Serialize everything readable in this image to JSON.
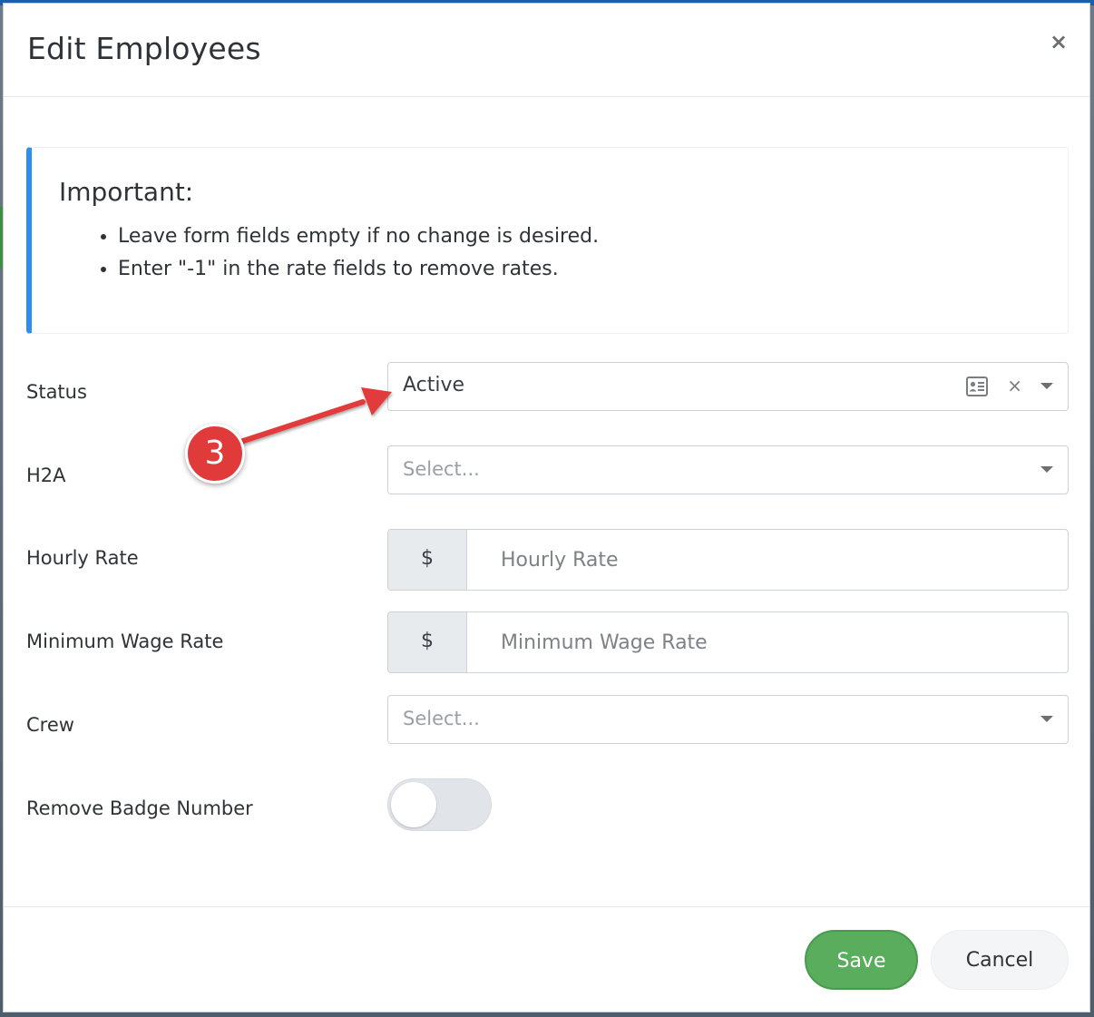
{
  "modal": {
    "title": "Edit Employees",
    "close_label": "×"
  },
  "alert": {
    "title": "Important:",
    "items": [
      "Leave form fields empty if no change is desired.",
      "Enter \"-1\" in the rate fields to remove rates."
    ],
    "accent_color": "#2d8ef0"
  },
  "form": {
    "status": {
      "label": "Status",
      "value": "Active",
      "clear_label": "×"
    },
    "h2a": {
      "label": "H2A",
      "placeholder": "Select..."
    },
    "hourly_rate": {
      "label": "Hourly Rate",
      "addon": "$",
      "placeholder": "Hourly Rate"
    },
    "minimum_wage_rate": {
      "label": "Minimum Wage Rate",
      "addon": "$",
      "placeholder": "Minimum Wage Rate"
    },
    "crew": {
      "label": "Crew",
      "placeholder": "Select..."
    },
    "remove_badge_number": {
      "label": "Remove Badge Number",
      "checked": false
    }
  },
  "footer": {
    "save_label": "Save",
    "cancel_label": "Cancel",
    "save_color": "#5aad5d"
  },
  "annotation": {
    "step_number": "3",
    "color": "#e13a3a"
  }
}
